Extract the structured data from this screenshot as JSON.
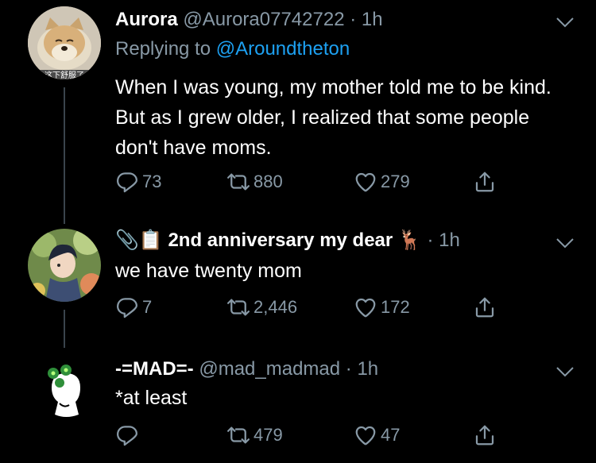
{
  "tweets": [
    {
      "name": "Aurora",
      "handle": "@Aurora07742722",
      "time": "· 1h",
      "reply_prefix": "Replying to",
      "reply_to": "@Aroundtheton",
      "avatar_caption": "这下舒服了",
      "text": "When I was young, my mother told me to be kind. But as I grew older, I realized that some people don't have moms.",
      "replies": "73",
      "retweets": "880",
      "likes": "279"
    },
    {
      "name_emoji": "📎📋",
      "name": "2nd anniversary my dear",
      "name_emoji_suffix": "🦌",
      "time": "· 1h",
      "text": "we have twenty mom",
      "replies": "7",
      "retweets": "2,446",
      "likes": "172"
    },
    {
      "name": "-=MAD=-",
      "handle": "@mad_madmad",
      "time": "· 1h",
      "text": "*at least",
      "replies": "",
      "retweets": "479",
      "likes": "47"
    }
  ],
  "colors": {
    "background": "#000000",
    "secondary_text": "#8899a6",
    "link": "#1da1f2",
    "thread_line": "#3a444c"
  },
  "icons": [
    "reply-icon",
    "retweet-icon",
    "like-icon",
    "share-icon",
    "chevron-down-icon"
  ]
}
